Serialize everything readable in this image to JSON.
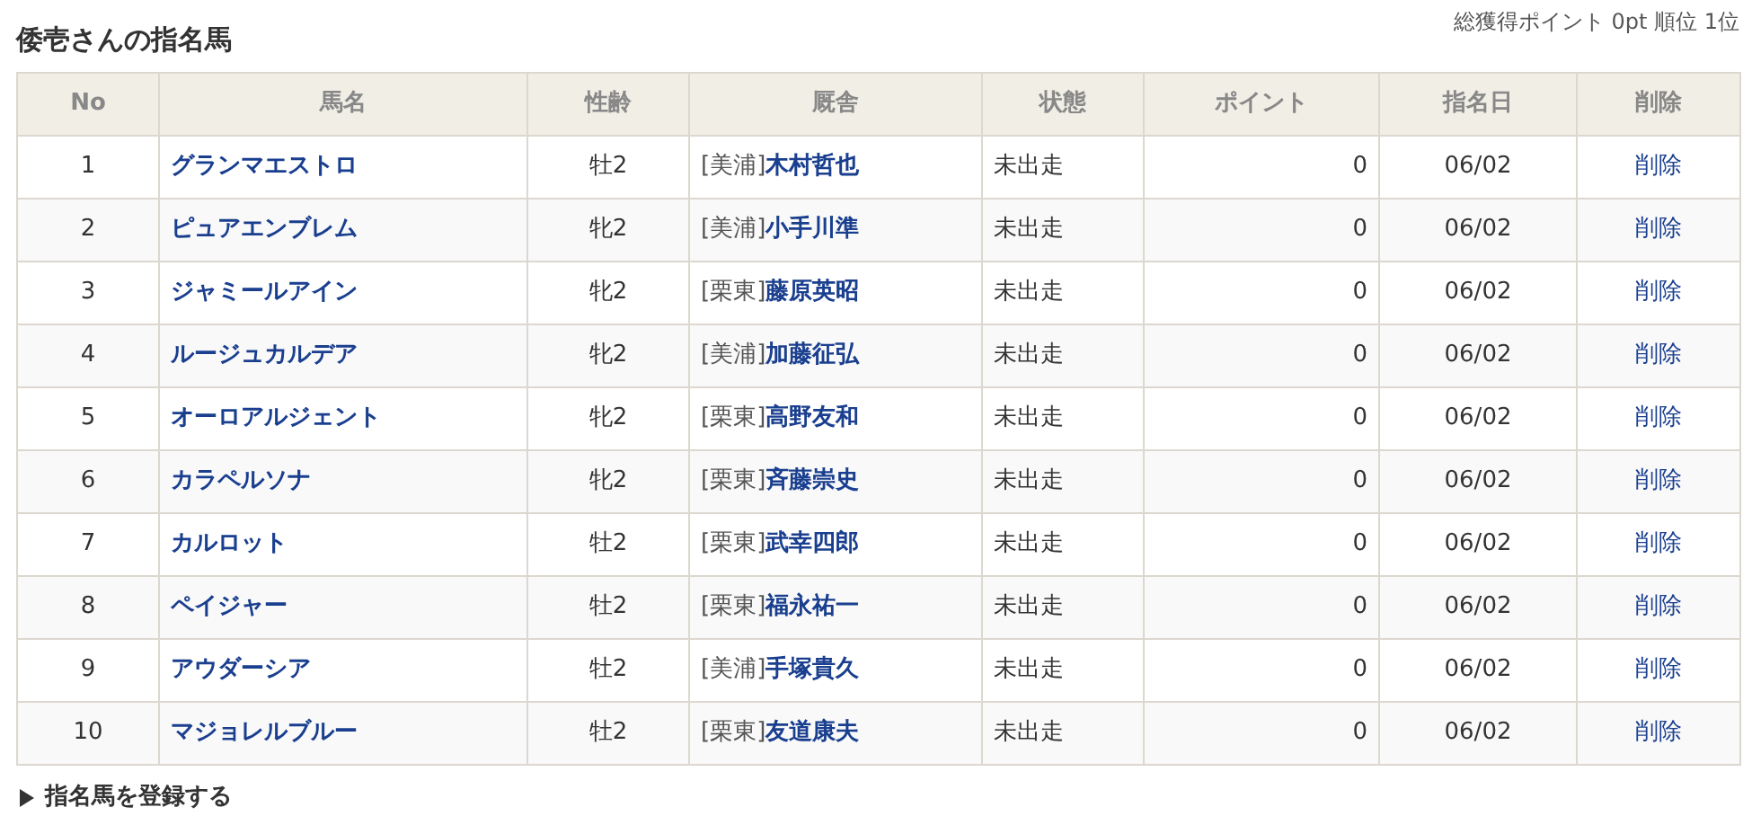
{
  "title": "倭壱さんの指名馬",
  "summary": "総獲得ポイント 0pt 順位 1位",
  "table": {
    "columns": [
      "No",
      "馬名",
      "性齢",
      "厩舎",
      "状態",
      "ポイント",
      "指名日",
      "削除"
    ],
    "rows": [
      {
        "no": "1",
        "horse": "グランマエストロ",
        "sex_age": "牡2",
        "region": "[美浦]",
        "trainer": "木村哲也",
        "status": "未出走",
        "points": "0",
        "date": "06/02",
        "delete": "削除"
      },
      {
        "no": "2",
        "horse": "ピュアエンブレム",
        "sex_age": "牝2",
        "region": "[美浦]",
        "trainer": "小手川準",
        "status": "未出走",
        "points": "0",
        "date": "06/02",
        "delete": "削除"
      },
      {
        "no": "3",
        "horse": "ジャミールアイン",
        "sex_age": "牝2",
        "region": "[栗東]",
        "trainer": "藤原英昭",
        "status": "未出走",
        "points": "0",
        "date": "06/02",
        "delete": "削除"
      },
      {
        "no": "4",
        "horse": "ルージュカルデア",
        "sex_age": "牝2",
        "region": "[美浦]",
        "trainer": "加藤征弘",
        "status": "未出走",
        "points": "0",
        "date": "06/02",
        "delete": "削除"
      },
      {
        "no": "5",
        "horse": "オーロアルジェント",
        "sex_age": "牝2",
        "region": "[栗東]",
        "trainer": "高野友和",
        "status": "未出走",
        "points": "0",
        "date": "06/02",
        "delete": "削除"
      },
      {
        "no": "6",
        "horse": "カラペルソナ",
        "sex_age": "牝2",
        "region": "[栗東]",
        "trainer": "斉藤崇史",
        "status": "未出走",
        "points": "0",
        "date": "06/02",
        "delete": "削除"
      },
      {
        "no": "7",
        "horse": "カルロット",
        "sex_age": "牡2",
        "region": "[栗東]",
        "trainer": "武幸四郎",
        "status": "未出走",
        "points": "0",
        "date": "06/02",
        "delete": "削除"
      },
      {
        "no": "8",
        "horse": "ペイジャー",
        "sex_age": "牡2",
        "region": "[栗東]",
        "trainer": "福永祐一",
        "status": "未出走",
        "points": "0",
        "date": "06/02",
        "delete": "削除"
      },
      {
        "no": "9",
        "horse": "アウダーシア",
        "sex_age": "牡2",
        "region": "[美浦]",
        "trainer": "手塚貴久",
        "status": "未出走",
        "points": "0",
        "date": "06/02",
        "delete": "削除"
      },
      {
        "no": "10",
        "horse": "マジョレルブルー",
        "sex_age": "牡2",
        "region": "[栗東]",
        "trainer": "友道康夫",
        "status": "未出走",
        "points": "0",
        "date": "06/02",
        "delete": "削除"
      }
    ]
  },
  "footer_link": "指名馬を登録する"
}
